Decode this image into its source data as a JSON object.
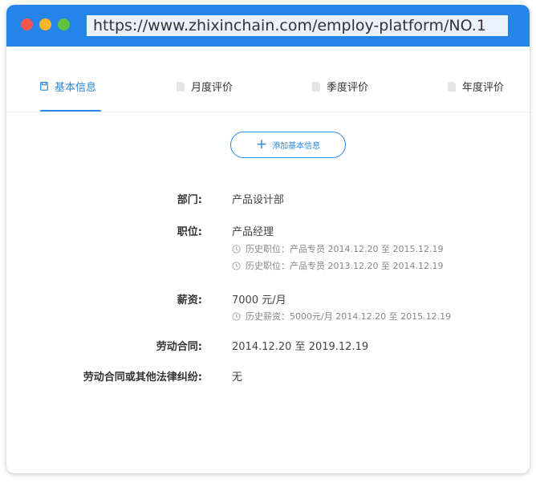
{
  "browser": {
    "url": "https://www.zhixinchain.com/employ-platform/NO.1"
  },
  "tabs": [
    {
      "label": "基本信息",
      "icon": "save-icon"
    },
    {
      "label": "月度评价",
      "icon": "document-icon"
    },
    {
      "label": "季度评价",
      "icon": "document-icon"
    },
    {
      "label": "年度评价",
      "icon": "document-icon"
    }
  ],
  "add_button": {
    "label": "添加基本信息"
  },
  "fields": {
    "department": {
      "label": "部门:",
      "value": "产品设计部"
    },
    "position": {
      "label": "职位:",
      "value": "产品经理",
      "history": [
        "历史职位：产品专员 2014.12.20 至 2015.12.19",
        "历史职位：产品专员 2013.12.20 至 2014.12.19"
      ]
    },
    "salary": {
      "label": "薪资:",
      "value": "7000 元/月",
      "history": [
        "历史薪资：5000元/月 2014.12.20 至 2015.12.19"
      ]
    },
    "contract": {
      "label": "劳动合同:",
      "value": "2014.12.20 至 2019.12.19"
    },
    "disputes": {
      "label": "劳动合同或其他法律纠纷:",
      "value": "无"
    }
  },
  "colors": {
    "accent": "#2a86e5",
    "titlebar": "#2584e8",
    "dot_red": "#f2574f",
    "dot_yellow": "#f9b52a",
    "dot_green": "#5fc241"
  }
}
